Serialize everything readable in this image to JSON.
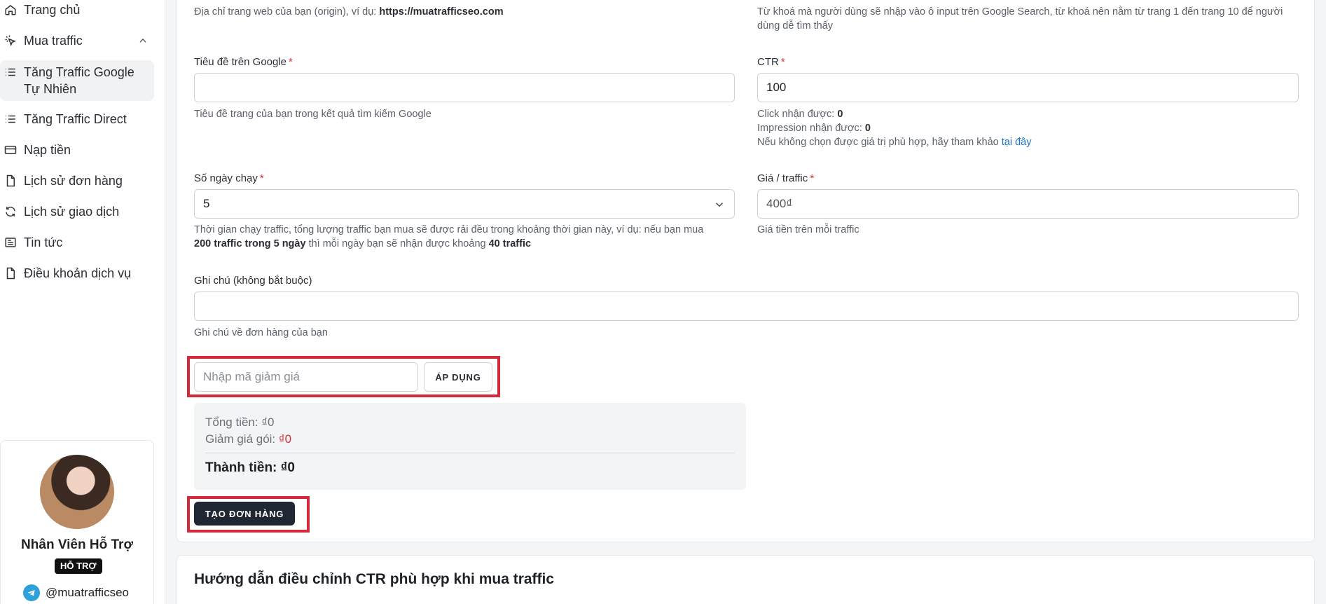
{
  "sidebar": {
    "items": [
      {
        "label": "Trang chủ",
        "icon": "home-icon"
      },
      {
        "label": "Mua traffic",
        "icon": "cursor-click-icon"
      },
      {
        "label": "Tăng Traffic Google Tự Nhiên",
        "icon": "list-icon"
      },
      {
        "label": "Tăng Traffic Direct",
        "icon": "list-icon"
      },
      {
        "label": "Nạp tiền",
        "icon": "credit-card-icon"
      },
      {
        "label": "Lịch sử đơn hàng",
        "icon": "document-icon"
      },
      {
        "label": "Lịch sử giao dịch",
        "icon": "refresh-icon"
      },
      {
        "label": "Tin tức",
        "icon": "newspaper-icon"
      },
      {
        "label": "Điều khoản dịch vụ",
        "icon": "document-icon"
      }
    ],
    "support": {
      "name": "Nhân Viên Hỗ Trợ",
      "badge": "HỖ TRỢ",
      "handle": "@muatrafficseo"
    }
  },
  "form": {
    "origin_help_prefix": "Địa chỉ trang web của bạn (origin), ví dụ: ",
    "origin_help_example": "https://muatrafficseo.com",
    "keyword_help": "Từ khoá mà người dùng sẽ nhập vào ô input trên Google Search, từ khoá nên nằm từ trang 1 đến trang 10 để người dùng dễ tìm thấy",
    "title_label": "Tiêu đề trên Google",
    "title_value": "",
    "title_help": "Tiêu đề trang của bạn trong kết quả tìm kiếm Google",
    "ctr_label": "CTR",
    "ctr_value": "100",
    "click_label": "Click nhận được: ",
    "click_value": "0",
    "impression_label": "Impression nhận được: ",
    "impression_value": "0",
    "ctr_hint_prefix": "Nếu không chọn được giá trị phù hợp, hãy tham khảo ",
    "ctr_hint_link": "tại đây",
    "days_label": "Số ngày chạy",
    "days_value": "5",
    "days_help_1": "Thời gian chạy traffic, tổng lượng traffic bạn mua sẽ được rải đều trong khoảng thời gian này, ví dụ: nếu bạn mua",
    "days_help_bold1": "200 traffic trong 5 ngày",
    "days_help_2": " thì mỗi ngày bạn sẽ nhận được khoảng ",
    "days_help_bold2": "40 traffic",
    "price_label": "Giá / traffic",
    "price_value": "400₫",
    "price_help": "Giá tiền trên mỗi traffic",
    "note_label": "Ghi chú (không bắt buộc)",
    "note_value": "",
    "note_help": "Ghi chú về đơn hàng của bạn",
    "required_mark": "*"
  },
  "coupon": {
    "placeholder": "Nhập mã giảm giá",
    "apply_label": "ÁP DỤNG"
  },
  "summary": {
    "total_label": "Tổng tiền: ",
    "total_value": "₫0",
    "discount_label": "Giảm giá gói: ",
    "discount_value": "₫0",
    "final_label": "Thành tiền: ",
    "final_value": "₫0"
  },
  "submit_label": "TẠO ĐƠN HÀNG",
  "guide_title": "Hướng dẫn điều chỉnh CTR phù hợp khi mua traffic",
  "colors": {
    "required": "#d32f2f",
    "highlight_box": "#d32b3c",
    "button_dark": "#1f2733",
    "link": "#1a73c8"
  }
}
